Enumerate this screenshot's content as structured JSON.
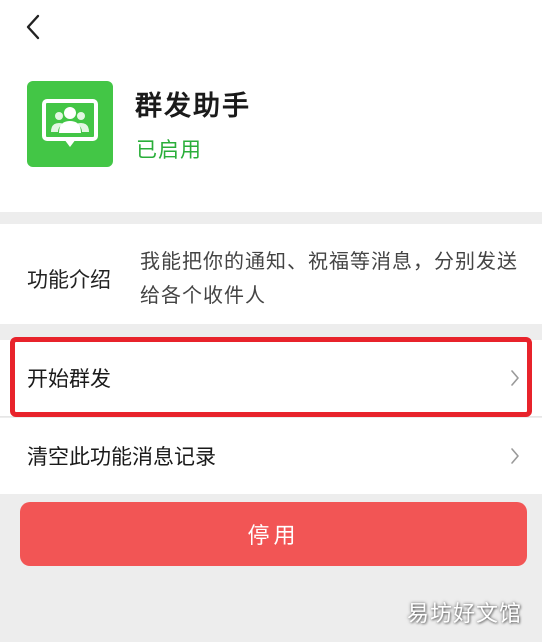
{
  "nav": {
    "back_icon": "chevron-left-icon"
  },
  "app": {
    "name": "群发助手",
    "status": "已启用",
    "icon": "group-chat-icon",
    "icon_color": "#43c646",
    "status_color": "#2aae3a"
  },
  "intro": {
    "label": "功能介绍",
    "text": "我能把你的通知、祝福等消息，分别发送给各个收件人"
  },
  "rows": [
    {
      "label": "开始群发",
      "icon": "chevron-right-icon",
      "highlighted": true
    },
    {
      "label": "清空此功能消息记录",
      "icon": "chevron-right-icon"
    }
  ],
  "disable_button": {
    "label": "停用",
    "color": "#f25555"
  },
  "highlight_color": "#e8232b",
  "watermark": "易坊好文馆"
}
